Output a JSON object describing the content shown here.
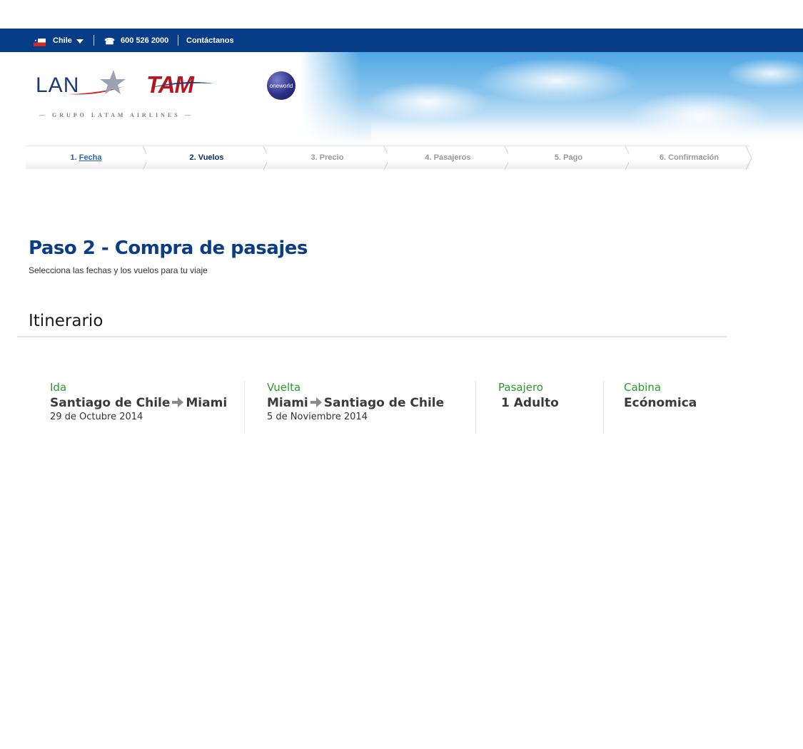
{
  "topbar": {
    "country": "Chile",
    "phone": "600 526 2000",
    "contact": "Contáctanos"
  },
  "header": {
    "lan_logo": "LAN",
    "tam_logo": "TAM",
    "oneworld_logo": "oneworld",
    "tagline": "— GRUPO   LATAM   AIRLINES —"
  },
  "steps": [
    {
      "number": "1.",
      "label": "Fecha",
      "state": "done"
    },
    {
      "number": "2.",
      "label": "Vuelos",
      "state": "current"
    },
    {
      "number": "3.",
      "label": "Precio",
      "state": "pending"
    },
    {
      "number": "4.",
      "label": "Pasajeros",
      "state": "pending"
    },
    {
      "number": "5.",
      "label": "Pago",
      "state": "pending"
    },
    {
      "number": "6.",
      "label": "Confirmación",
      "state": "pending"
    }
  ],
  "main": {
    "title": "Paso 2 - Compra de pasajes",
    "subtitle": "Selecciona las fechas y los vuelos para tu viaje",
    "section_title": "Itinerario"
  },
  "itinerary": {
    "outbound": {
      "label": "Ida",
      "origin": "Santiago de Chile",
      "destination": "Miami",
      "date": "29 de Octubre 2014"
    },
    "return": {
      "label": "Vuelta",
      "origin": "Miami",
      "destination": "Santiago de Chile",
      "date": "5 de Noviembre 2014"
    },
    "passenger": {
      "label": "Pasajero",
      "value": "1 Adulto"
    },
    "cabin": {
      "label": "Cabina",
      "value": "Ecónomica"
    }
  },
  "colors": {
    "topbar_bg": "#063d86",
    "title_blue": "#0a3d84",
    "label_green": "#2b9a2b",
    "tam_red": "#b7161e"
  },
  "icons": {
    "flag": "chile-flag-icon",
    "dropdown": "caret-down-icon",
    "phone": "phone-icon",
    "arrow": "arrow-right-icon"
  }
}
